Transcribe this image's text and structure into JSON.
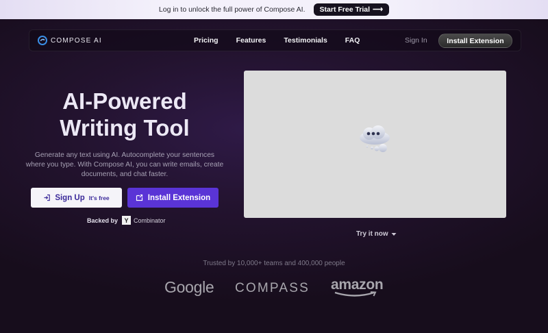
{
  "banner": {
    "text": "Log in to unlock the full power of Compose AI.",
    "cta_label": "Start Free Trial",
    "cta_arrow": "⟶"
  },
  "nav": {
    "logo_text": "COMPOSE AI",
    "links": [
      "Pricing",
      "Features",
      "Testimonials",
      "FAQ"
    ],
    "sign_in": "Sign In",
    "install": "Install Extension"
  },
  "hero": {
    "title_line1": "AI-Powered",
    "title_line2": "Writing Tool",
    "description": "Generate any text using AI. Autocomplete your sentences where you type. With Compose AI, you can write emails, create documents, and chat faster.",
    "signup_label": "Sign Up",
    "signup_sub": "It's free",
    "install_label": "Install Extension",
    "backed_label": "Backed by",
    "yc_letter": "Y",
    "yc_text": "Combinator"
  },
  "preview": {
    "try_label": "Try it now",
    "icon": "thinking-cloud-icon"
  },
  "trusted": {
    "text": "Trusted by 10,000+ teams and 400,000 people",
    "brands": [
      "Google",
      "COMPASS",
      "amazon"
    ]
  },
  "colors": {
    "accent": "#5a34d6",
    "background": "#1b0f22",
    "banner": "#f4f1fb"
  }
}
